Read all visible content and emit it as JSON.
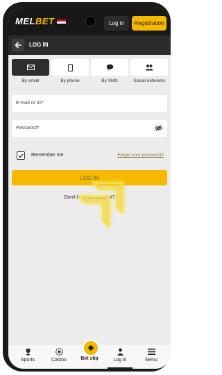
{
  "app": {
    "brand_left": "MEL",
    "brand_right": "BET",
    "accent_color": "#f6b900",
    "header_bg": "#181818"
  },
  "header": {
    "login_label": "Log in",
    "register_label": "Registration"
  },
  "subheader": {
    "title": "LOG IN"
  },
  "tabs": [
    {
      "label": "By email",
      "icon": "envelope-icon",
      "active": true
    },
    {
      "label": "By phone",
      "icon": "phone-icon",
      "active": false
    },
    {
      "label": "By SMS",
      "icon": "chat-icon",
      "active": false
    },
    {
      "label": "Social networks",
      "icon": "people-icon",
      "active": false
    }
  ],
  "form": {
    "email_placeholder": "E-mail or ID*",
    "password_placeholder": "Password*",
    "remember_label": "Remember me",
    "remember_checked": true,
    "forgot_label": "Forgot your password?",
    "login_button": "LOG IN",
    "no_account": "Don't have an account?"
  },
  "bottom_nav": [
    {
      "label": "Sports",
      "icon": "trophy-icon"
    },
    {
      "label": "Casino",
      "icon": "casino-chip-icon"
    },
    {
      "label": "Bet slip",
      "icon": "ticket-icon"
    },
    {
      "label": "Log in",
      "icon": "user-icon",
      "active": true
    },
    {
      "label": "Menu",
      "icon": "menu-icon"
    }
  ]
}
